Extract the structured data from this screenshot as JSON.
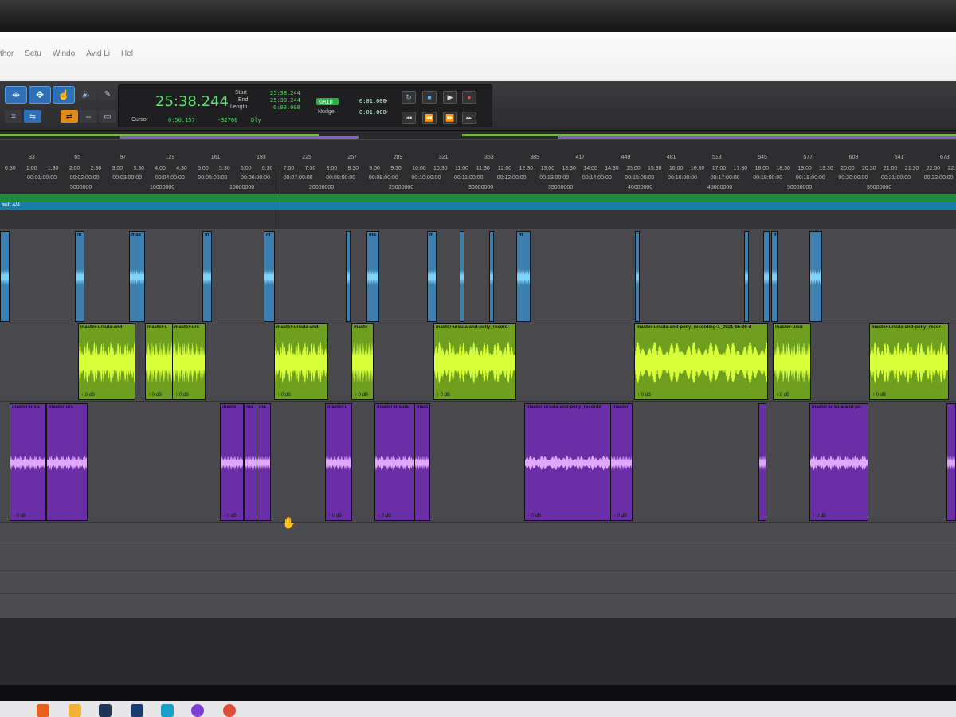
{
  "menu": {
    "items": [
      "thor",
      "Setu",
      "Windo",
      "Avid Li",
      "Hel"
    ]
  },
  "toolbar": {
    "tools": [
      "trim-tool",
      "selector-tool",
      "grabber-tool"
    ],
    "counter_main": "25:38.244",
    "counter_label": "Cursor",
    "cursor_value": "0:50.157",
    "sample_value": "-32768",
    "dly_label": "Dly",
    "start_label": "Start",
    "end_label": "End",
    "length_label": "Length",
    "start_value": "25:38.244",
    "end_value": "25:38.244",
    "length_value": "0:00.000",
    "nudge_label": "Nudge",
    "nudge_led": "GRID",
    "grid_value": "0:01.000",
    "nudge_value": "0:01.000"
  },
  "ruler": {
    "bars": [
      "33",
      "65",
      "97",
      "129",
      "161",
      "193",
      "225",
      "257",
      "289",
      "321",
      "353",
      "385",
      "417",
      "449",
      "481",
      "513",
      "545",
      "577",
      "609",
      "641",
      "673"
    ],
    "minsecs": [
      "0:30",
      "1:00",
      "1:30",
      "2:00",
      "2:30",
      "3:00",
      "3:30",
      "4:00",
      "4:30",
      "5:00",
      "5:30",
      "6:00",
      "6:30",
      "7:00",
      "7:30",
      "8:00",
      "8:30",
      "9:00",
      "9:30",
      "10:00",
      "10:30",
      "11:00",
      "11:30",
      "12:00",
      "12:30",
      "13:00",
      "13:30",
      "14:00",
      "14:30",
      "15:00",
      "15:30",
      "16:00",
      "16:30",
      "17:00",
      "17:30",
      "18:00",
      "18:30",
      "19:00",
      "19:30",
      "20:00",
      "20:30",
      "21:00",
      "21:30",
      "22:00",
      "22:30"
    ],
    "timecodes": [
      "00:01:00:00",
      "00:02:00:00",
      "00:03:00:00",
      "00:04:00:00",
      "00:05:00:00",
      "00:06:00:00",
      "00:07:00:00",
      "00:08:00:00",
      "00:09:00:00",
      "00:10:00:00",
      "00:11:00:00",
      "00:12:00:00",
      "00:13:00:00",
      "00:14:00:00",
      "00:15:00:00",
      "00:16:00:00",
      "00:17:00:00",
      "00:18:00:00",
      "00:19:00:00",
      "00:20:00:00",
      "00:21:00:00",
      "00:22:00:00"
    ],
    "samples": [
      "5000000",
      "10000000",
      "15000000",
      "20000000",
      "25000000",
      "30000000",
      "35000000",
      "40000000",
      "45000000",
      "50000000",
      "55000000"
    ],
    "meter_label": "ault 4/4"
  },
  "colors": {
    "blue_clip": "#3d7fae",
    "green_clip": "#6e9f1f",
    "purple_clip": "#6a2fa6",
    "blue_wave": "#7fd4f5",
    "green_wave": "#d7ff3a",
    "purple_wave": "#e2a8ff"
  },
  "tracks": {
    "blue": {
      "clips": [
        {
          "name": ""
        },
        {
          "name": "m"
        },
        {
          "name": "mas"
        },
        {
          "name": "m"
        },
        {
          "name": "m"
        },
        {
          "name": ""
        },
        {
          "name": "ma"
        },
        {
          "name": "m"
        },
        {
          "name": ""
        },
        {
          "name": ""
        },
        {
          "name": "m"
        },
        {
          "name": ""
        },
        {
          "name": ""
        },
        {
          "name": ""
        },
        {
          "name": "m"
        },
        {
          "name": ""
        }
      ]
    },
    "green": {
      "clips": [
        {
          "name": "master-ursula-and-",
          "gain": "0 dB"
        },
        {
          "name": "master-u",
          "gain": "0 dB"
        },
        {
          "name": "master-urs",
          "gain": "0 dB"
        },
        {
          "name": "master-ursula-and-",
          "gain": "0 dB"
        },
        {
          "name": "maste",
          "gain": "0 dB"
        },
        {
          "name": "master-ursula-and-polly_record",
          "gain": "0 dB"
        },
        {
          "name": "master-ursula-and-polly_recording-1_2021-05-26-d",
          "gain": "0 dB"
        },
        {
          "name": "master-ursu",
          "gain": "0 dB"
        },
        {
          "name": "master-ursula-and-polly_recor",
          "gain": "0 dB"
        }
      ]
    },
    "purple": {
      "clips": [
        {
          "name": "master-ursu",
          "gain": "0 dB"
        },
        {
          "name": "master-urs",
          "gain": ""
        },
        {
          "name": "maste",
          "gain": "0 dB"
        },
        {
          "name": "ma",
          "gain": ""
        },
        {
          "name": "ma",
          "gain": ""
        },
        {
          "name": "master-u",
          "gain": "0 dB"
        },
        {
          "name": "master-ursula-",
          "gain": "0 dB"
        },
        {
          "name": "mast",
          "gain": ""
        },
        {
          "name": "master-ursula-and-polly_recordir",
          "gain": "0 dB"
        },
        {
          "name": "master",
          "gain": "0 dB"
        },
        {
          "name": "",
          "gain": ""
        },
        {
          "name": "master-ursula-and-po",
          "gain": "0 dB"
        },
        {
          "name": "",
          "gain": ""
        }
      ]
    }
  }
}
